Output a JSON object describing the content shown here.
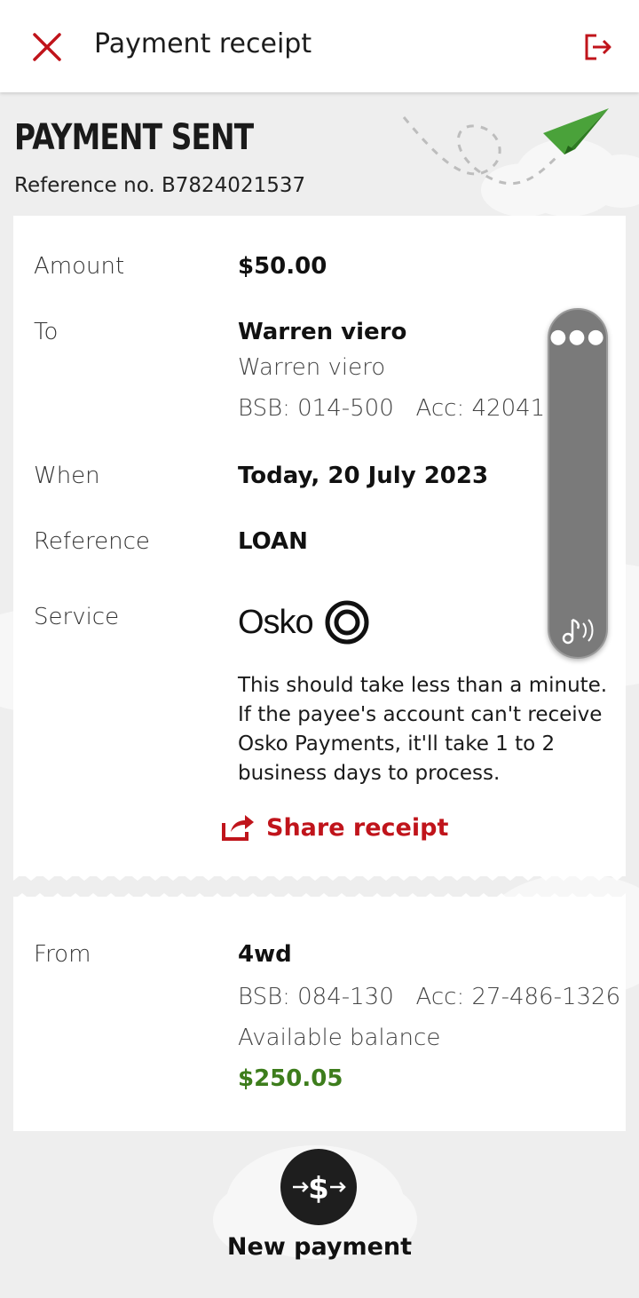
{
  "header": {
    "title": "Payment receipt",
    "close_icon": "close-icon",
    "logout_icon": "logout-icon"
  },
  "hero": {
    "title": "PAYMENT SENT",
    "reference_line": "Reference no. B7824021537"
  },
  "details": {
    "amount_label": "Amount",
    "amount_value": "$50.00",
    "to_label": "To",
    "to_name": "Warren viero",
    "to_subname": "Warren viero",
    "to_account": "BSB: 014-500   Acc: 420411316",
    "when_label": "When",
    "when_value": "Today, 20 July 2023",
    "reference_label": "Reference",
    "reference_value": "LOAN",
    "service_label": "Service",
    "service_brand": "Osko",
    "service_description": "This should take less than a minute. If the payee's account can't receive Osko Payments, it'll take 1 to 2 business days to process.",
    "share_label": "Share receipt"
  },
  "from": {
    "label": "From",
    "account_name": "4wd",
    "account_numbers": "BSB: 084-130   Acc: 27-486-1326",
    "balance_label": "Available balance",
    "balance_value": "$250.05"
  },
  "actions": {
    "new_payment_label": "New payment"
  },
  "colors": {
    "accent_red": "#c0141b",
    "balance_green": "#3d7d1c",
    "background": "#eeeeee"
  }
}
